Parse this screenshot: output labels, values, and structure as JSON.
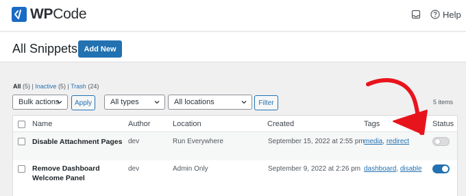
{
  "brand": {
    "name_strong": "WP",
    "name_rest": "Code"
  },
  "topbar": {
    "help_label": "Help"
  },
  "header": {
    "title": "All Snippets",
    "add_new_label": "Add New"
  },
  "filters": {
    "all_label": "All",
    "all_count": "(5)",
    "inactive_label": "Inactive",
    "inactive_count": "(5)",
    "trash_label": "Trash",
    "trash_count": "(24)"
  },
  "toolbar": {
    "bulk_actions": "Bulk actions",
    "apply_label": "Apply",
    "types": "All types",
    "locations": "All locations",
    "filter_label": "Filter",
    "items_count": "5 items"
  },
  "table": {
    "columns": {
      "name": "Name",
      "author": "Author",
      "location": "Location",
      "created": "Created",
      "tags": "Tags",
      "status": "Status"
    },
    "rows": [
      {
        "name": "Disable Attachment Pages",
        "author": "dev",
        "location": "Run Everywhere",
        "created": "September 15, 2022 at 2:55 pm",
        "tags": [
          "media",
          "redirect"
        ],
        "status": "inactive"
      },
      {
        "name_line1": "Remove Dashboard",
        "name_line2": "Welcome Panel",
        "author": "dev",
        "location": "Admin Only",
        "created": "September 9, 2022 at 2:26 pm",
        "tags": [
          "dashboard",
          "disable"
        ],
        "status": "active"
      }
    ]
  },
  "colors": {
    "accent": "#2271b1",
    "arrow": "#e8141c",
    "brand": "#1b6ac5"
  }
}
